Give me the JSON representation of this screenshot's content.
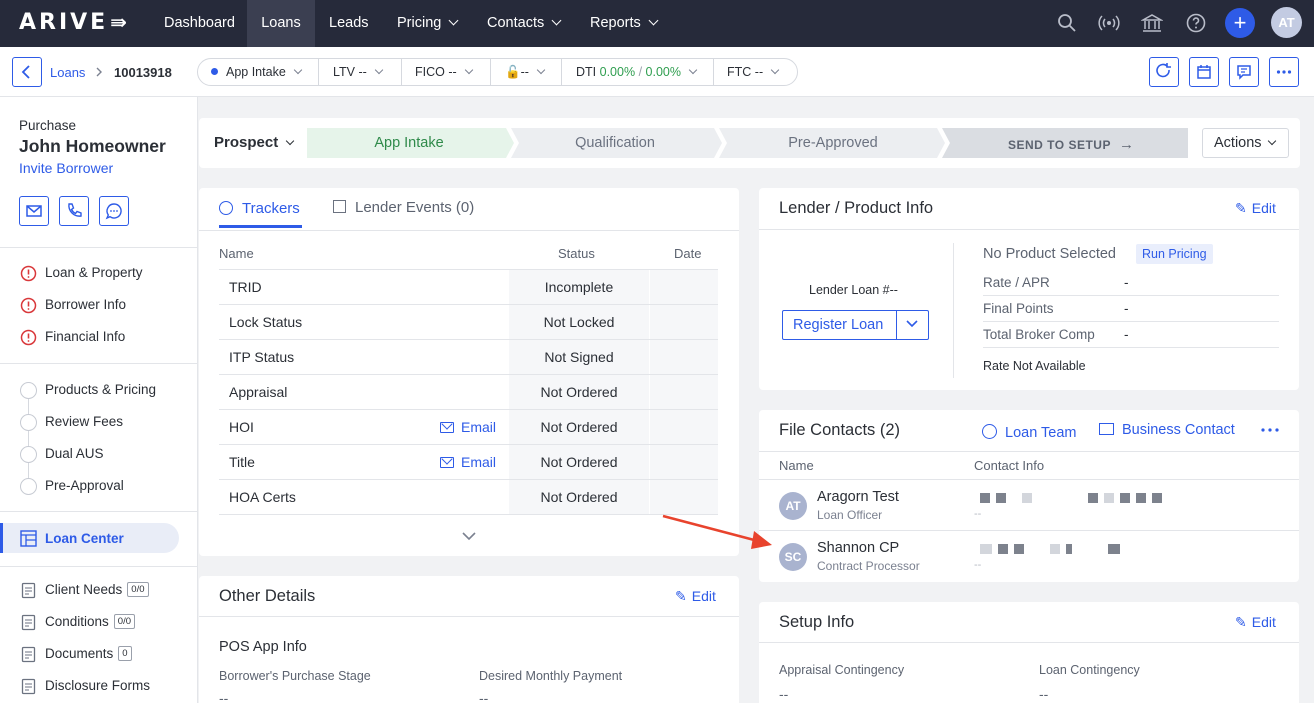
{
  "nav": {
    "logo": "ARIVE",
    "items": [
      "Dashboard",
      "Loans",
      "Leads",
      "Pricing",
      "Contacts",
      "Reports"
    ],
    "avatar": "AT"
  },
  "breadcrumb": {
    "loans": "Loans",
    "loan_id": "10013918"
  },
  "metrics": {
    "stage": "App Intake",
    "ltv_label": "LTV",
    "ltv": "--",
    "fico_label": "FICO",
    "fico": "--",
    "lock": "--",
    "dti_label": "DTI",
    "dti_a": "0.00%",
    "dti_sep": "/",
    "dti_b": "0.00%",
    "ftc_label": "FTC",
    "ftc": "--"
  },
  "sidebar": {
    "purpose": "Purchase",
    "borrower": "John Homeowner",
    "invite": "Invite Borrower",
    "warn_items": [
      "Loan & Property",
      "Borrower Info",
      "Financial Info"
    ],
    "steps": [
      "Products & Pricing",
      "Review Fees",
      "Dual AUS",
      "Pre-Approval"
    ],
    "loan_center": "Loan Center",
    "bottom": [
      {
        "label": "Client Needs",
        "badge": "0/0"
      },
      {
        "label": "Conditions",
        "badge": "0/0"
      },
      {
        "label": "Documents",
        "badge": "0"
      },
      {
        "label": "Disclosure Forms",
        "badge": ""
      }
    ]
  },
  "pipeline": {
    "status": "Prospect",
    "stages": [
      "App Intake",
      "Qualification",
      "Pre-Approved"
    ],
    "send": "SEND TO SETUP",
    "actions": "Actions"
  },
  "trackers": {
    "tab_trackers": "Trackers",
    "tab_events": "Lender Events (0)",
    "col_name": "Name",
    "col_status": "Status",
    "col_date": "Date",
    "email": "Email",
    "rows": [
      {
        "name": "TRID",
        "status": "Incomplete",
        "email": false
      },
      {
        "name": "Lock Status",
        "status": "Not Locked",
        "email": false
      },
      {
        "name": "ITP Status",
        "status": "Not Signed",
        "email": false
      },
      {
        "name": "Appraisal",
        "status": "Not Ordered",
        "email": false
      },
      {
        "name": "HOI",
        "status": "Not Ordered",
        "email": true
      },
      {
        "name": "Title",
        "status": "Not Ordered",
        "email": true
      },
      {
        "name": "HOA Certs",
        "status": "Not Ordered",
        "email": false
      }
    ]
  },
  "other": {
    "title": "Other Details",
    "edit": "Edit",
    "section": "POS App Info",
    "f1_label": "Borrower's Purchase Stage",
    "f1": "--",
    "f2_label": "Desired Monthly Payment",
    "f2": "--"
  },
  "lender": {
    "title": "Lender / Product Info",
    "edit": "Edit",
    "loan_no": "Lender Loan #--",
    "register": "Register Loan",
    "no_product": "No Product Selected",
    "run_pricing": "Run Pricing",
    "rows": [
      {
        "label": "Rate / APR",
        "value": "-"
      },
      {
        "label": "Final Points",
        "value": "-"
      },
      {
        "label": "Total Broker Comp",
        "value": "-"
      }
    ],
    "rate_na": "Rate Not Available"
  },
  "contacts": {
    "title": "File Contacts (2)",
    "loan_team": "Loan Team",
    "business": "Business Contact",
    "col_name": "Name",
    "col_info": "Contact Info",
    "list": [
      {
        "initials": "AT",
        "name": "Aragorn Test",
        "role": "Loan Officer",
        "sub": "--"
      },
      {
        "initials": "SC",
        "name": "Shannon CP",
        "role": "Contract Processor",
        "sub": "--"
      }
    ]
  },
  "setup": {
    "title": "Setup Info",
    "edit": "Edit",
    "f1_label": "Appraisal Contingency",
    "f1": "--",
    "f2_label": "Loan Contingency",
    "f2": "--"
  },
  "colors": {
    "accent": "#2e5be7",
    "nav_bg": "#262a3a",
    "warn": "#d9383b",
    "arrow": "#e8432d",
    "stage_active": "#e6f4ea"
  }
}
